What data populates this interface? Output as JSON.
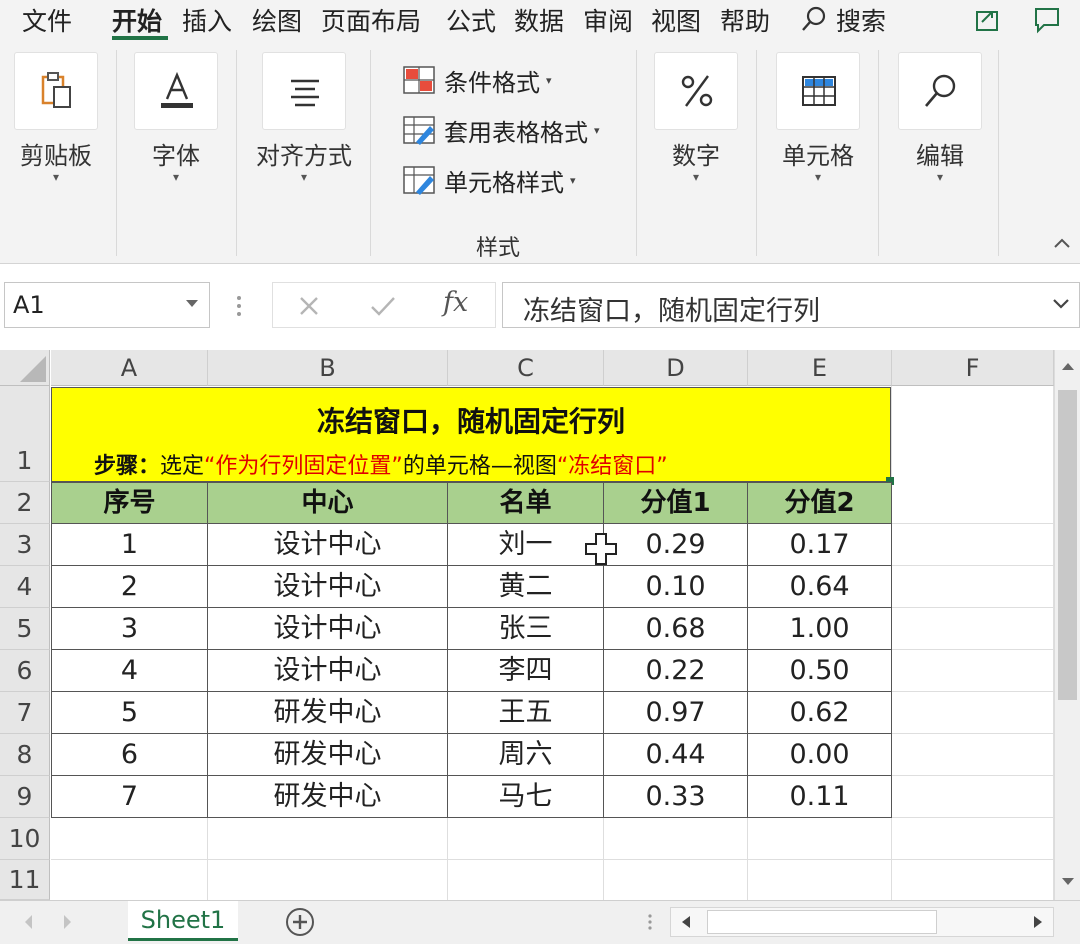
{
  "menu": {
    "tabs": [
      "文件",
      "开始",
      "插入",
      "绘图",
      "页面布局",
      "公式",
      "数据",
      "审阅",
      "视图",
      "帮助"
    ],
    "active_tab": "开始",
    "search_label": "搜索"
  },
  "ribbon": {
    "clipboard_label": "剪贴板",
    "font_label": "字体",
    "align_label": "对齐方式",
    "styles": {
      "conditional_format": "条件格式",
      "table_format": "套用表格格式",
      "cell_style": "单元格样式",
      "group_title": "样式"
    },
    "number_label": "数字",
    "cells_label": "单元格",
    "edit_label": "编辑"
  },
  "formula_bar": {
    "name_box": "A1",
    "fx_label": "fx",
    "content": "冻结窗口，随机固定行列"
  },
  "grid": {
    "columns": [
      "A",
      "B",
      "C",
      "D",
      "E",
      "F"
    ],
    "rows": [
      "1",
      "2",
      "3",
      "4",
      "5",
      "6",
      "7",
      "8",
      "9",
      "10",
      "11"
    ],
    "title": "冻结窗口，随机固定行列",
    "subtitle": {
      "prefix": "步骤：",
      "part1": "选定",
      "quote1": "“作为行列固定位置”",
      "part2": "的单元格—视图",
      "quote2": "“冻结窗口”"
    },
    "headers": [
      "序号",
      "中心",
      "名单",
      "分值1",
      "分值2"
    ],
    "data_rows": [
      [
        "1",
        "设计中心",
        "刘一",
        "0.29",
        "0.17"
      ],
      [
        "2",
        "设计中心",
        "黄二",
        "0.10",
        "0.64"
      ],
      [
        "3",
        "设计中心",
        "张三",
        "0.68",
        "1.00"
      ],
      [
        "4",
        "设计中心",
        "李四",
        "0.22",
        "0.50"
      ],
      [
        "5",
        "研发中心",
        "王五",
        "0.97",
        "0.62"
      ],
      [
        "6",
        "研发中心",
        "周六",
        "0.44",
        "0.00"
      ],
      [
        "7",
        "研发中心",
        "马七",
        "0.33",
        "0.11"
      ]
    ]
  },
  "sheet_tabs": {
    "active": "Sheet1"
  },
  "colors": {
    "title_fill": "#ffff00",
    "header_fill": "#a9d08e",
    "accent": "#217346",
    "red_text": "#e00000"
  }
}
